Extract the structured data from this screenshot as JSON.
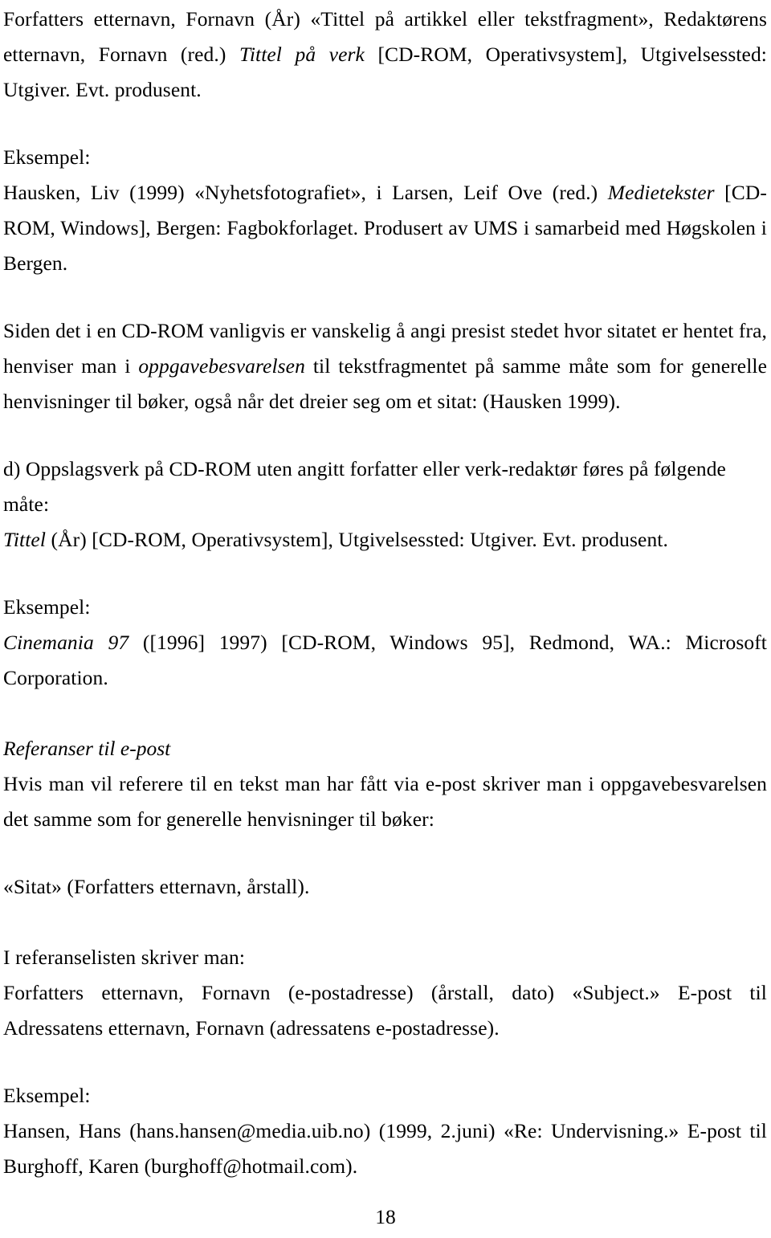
{
  "document": {
    "page_number": "18",
    "language": "no",
    "blocks": [
      {
        "id": "ref_format_article_cdrom",
        "type": "paragraph",
        "segments": [
          {
            "text": "Forfatters etternavn, Fornavn (År) «Tittel på artikkel eller tekstfragment», Redaktørens etternavn, Fornavn (red.) ",
            "style": "normal"
          },
          {
            "text": "Tittel på verk",
            "style": "italic"
          },
          {
            "text": " [CD-ROM, Operativsystem], Utgivelsessted: Utgiver. Evt. produsent.",
            "style": "normal"
          }
        ]
      },
      {
        "id": "eksempel_label_1",
        "type": "label",
        "segments": [
          {
            "text": "Eksempel:",
            "style": "normal"
          }
        ]
      },
      {
        "id": "eksempel_hausken",
        "type": "paragraph",
        "segments": [
          {
            "text": "Hausken, Liv (1999) «Nyhetsfotografiet», i Larsen, Leif Ove (red.) ",
            "style": "normal"
          },
          {
            "text": "Medietekster",
            "style": "italic"
          },
          {
            "text": " [CD-ROM, Windows], Bergen: Fagbokforlaget. Produsert av UMS i samarbeid med Høgskolen i Bergen.",
            "style": "normal"
          }
        ]
      },
      {
        "id": "cdrom_sitat_forklaring",
        "type": "paragraph",
        "segments": [
          {
            "text": "Siden det i en CD-ROM vanligvis er vanskelig å angi presist stedet hvor sitatet er hentet fra, henviser man i ",
            "style": "normal"
          },
          {
            "text": "oppgavebesvarelsen",
            "style": "italic"
          },
          {
            "text": " til tekstfragmentet på samme måte som for generelle henvisninger til bøker, også når det dreier seg om et sitat: (Hausken 1999).",
            "style": "normal"
          }
        ]
      },
      {
        "id": "punkt_d_oppslagsverk",
        "type": "paragraph",
        "segments": [
          {
            "text": "d) Oppslagsverk på CD-ROM uten angitt forfatter eller verk-redaktør føres på følgende måte:",
            "style": "normal"
          }
        ]
      },
      {
        "id": "format_oppslagsverk",
        "type": "paragraph",
        "segments": [
          {
            "text": "Tittel",
            "style": "italic"
          },
          {
            "text": " (År) [CD-ROM, Operativsystem], Utgivelsessted: Utgiver. Evt. produsent.",
            "style": "normal"
          }
        ]
      },
      {
        "id": "eksempel_label_2",
        "type": "label",
        "segments": [
          {
            "text": "Eksempel:",
            "style": "normal"
          }
        ]
      },
      {
        "id": "eksempel_cinemania",
        "type": "paragraph",
        "segments": [
          {
            "text": "Cinemania 97",
            "style": "italic"
          },
          {
            "text": " ([1996] 1997) [CD-ROM, Windows 95], Redmond, WA.: Microsoft Corporation.",
            "style": "normal"
          }
        ]
      },
      {
        "id": "heading_referanser_epost",
        "type": "heading",
        "segments": [
          {
            "text": "Referanser til e-post",
            "style": "italic"
          }
        ]
      },
      {
        "id": "epost_intro",
        "type": "paragraph",
        "segments": [
          {
            "text": "Hvis man vil referere til en tekst man har fått via e-post skriver man i oppgavebesvarelsen det samme som for generelle henvisninger til bøker:",
            "style": "normal"
          }
        ]
      },
      {
        "id": "sitat_format",
        "type": "paragraph",
        "segments": [
          {
            "text": "«Sitat» (Forfatters etternavn, årstall).",
            "style": "normal"
          }
        ]
      },
      {
        "id": "referanselisten_intro",
        "type": "paragraph",
        "segments": [
          {
            "text": "I referanselisten skriver man:",
            "style": "normal"
          }
        ]
      },
      {
        "id": "epost_format",
        "type": "paragraph",
        "segments": [
          {
            "text": "Forfatters etternavn, Fornavn (e-postadresse) (årstall, dato) «Subject.» E-post til Adressatens etternavn, Fornavn (adressatens e-postadresse).",
            "style": "normal"
          }
        ]
      },
      {
        "id": "eksempel_label_3",
        "type": "label",
        "segments": [
          {
            "text": "Eksempel:",
            "style": "normal"
          }
        ]
      },
      {
        "id": "eksempel_hansen",
        "type": "paragraph",
        "segments": [
          {
            "text": "Hansen, Hans (hans.hansen@media.uib.no) (1999, 2.juni) «Re: Undervisning.» E-post til Burghoff, Karen (burghoff@hotmail.com).",
            "style": "normal"
          }
        ]
      }
    ]
  }
}
